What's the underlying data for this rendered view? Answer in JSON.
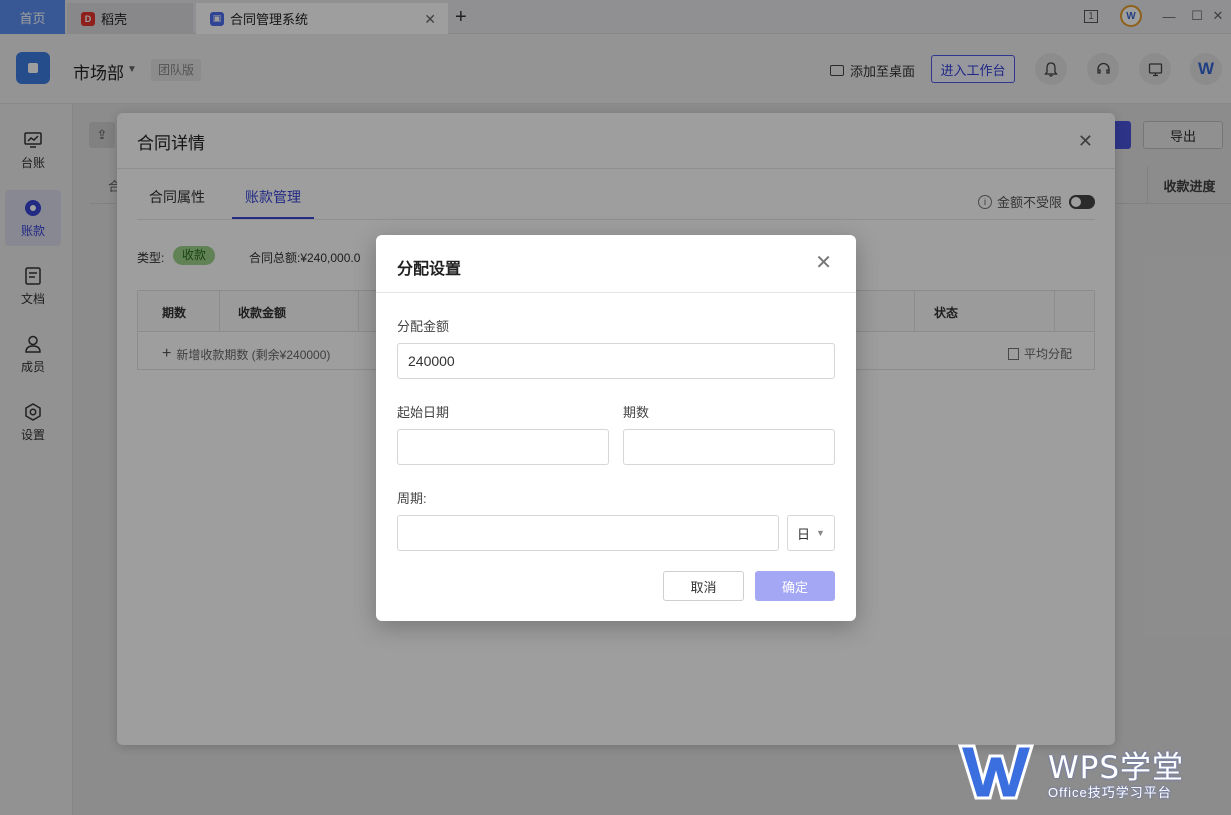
{
  "browser": {
    "home_tab": "首页",
    "tabs": [
      {
        "label": "稻壳",
        "icon": "docer-icon"
      },
      {
        "label": "合同管理系统",
        "icon": "contract-app-icon"
      }
    ],
    "new_tab": "+",
    "window_badge": "1"
  },
  "header": {
    "department": "市场部",
    "edition": "团队版",
    "add_to_desktop": "添加至桌面",
    "enter_workbench": "进入工作台"
  },
  "sidebar": {
    "items": [
      {
        "label": "台账",
        "icon": "chart-icon"
      },
      {
        "label": "账款",
        "icon": "money-icon",
        "active": true
      },
      {
        "label": "文档",
        "icon": "document-icon"
      },
      {
        "label": "成员",
        "icon": "user-icon"
      },
      {
        "label": "设置",
        "icon": "settings-icon"
      }
    ]
  },
  "background": {
    "export_label": "导出",
    "column_progress": "收款进度",
    "partial_col": "合"
  },
  "contract_panel": {
    "title": "合同详情",
    "tabs": [
      "合同属性",
      "账款管理"
    ],
    "active_tab": "账款管理",
    "amount_unlimited": "金额不受限",
    "type_label": "类型:",
    "type_value": "收款",
    "total_label": "合同总额:¥240,000.0",
    "table_headers": [
      "期数",
      "收款金额",
      "状态"
    ],
    "add_period": "新增收款期数 (剩余¥240000)",
    "average_allocate": "平均分配"
  },
  "dialog": {
    "title": "分配设置",
    "amount_label": "分配金额",
    "amount_value": "240000",
    "start_date_label": "起始日期",
    "start_date_value": "",
    "periods_label": "期数",
    "periods_value": "",
    "cycle_label": "周期:",
    "cycle_value": "",
    "cycle_unit": "日",
    "cancel": "取消",
    "confirm": "确定"
  },
  "watermark": {
    "brand": "WPS学堂",
    "subtitle": "Office技巧学习平台"
  },
  "colors": {
    "accent": "#3944d6",
    "confirm_disabled": "#a4a8f4",
    "tag_green": "#9bd28a",
    "home_tab": "#5b8ef0"
  }
}
